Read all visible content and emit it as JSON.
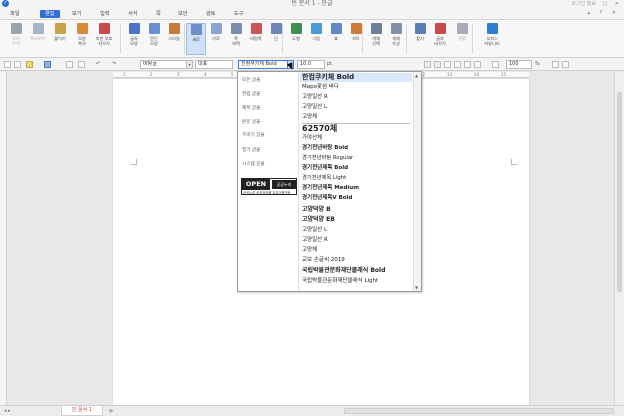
{
  "window": {
    "title": "빈 문서 1 - 한글",
    "logo": "✓",
    "login": "로그인 필요",
    "controls": "─ □ ✕"
  },
  "menubar": {
    "items": [
      {
        "label": "파일",
        "active": false
      },
      {
        "label": "편집",
        "active": true
      },
      {
        "label": "보기",
        "active": false
      },
      {
        "label": "입력",
        "active": false
      },
      {
        "label": "서식",
        "active": false
      },
      {
        "label": "쪽",
        "active": false
      },
      {
        "label": "보안",
        "active": false
      },
      {
        "label": "검토",
        "active": false
      },
      {
        "label": "도구",
        "active": false
      }
    ],
    "right_icons": "▴ ? ✕"
  },
  "ribbon": {
    "buttons": [
      {
        "label": "오려\n두기",
        "icon": "scissors-icon",
        "color": "#9aa3ad",
        "dim": true
      },
      {
        "label": "복사하기",
        "icon": "copy-icon",
        "color": "#a8b4c4",
        "dim": true
      },
      {
        "label": "붙이기",
        "icon": "paste-icon",
        "color": "#c9a24a",
        "dim": false
      },
      {
        "label": "모양\n복사",
        "icon": "format-painter-icon",
        "color": "#d68a3a",
        "dim": false
      },
      {
        "label": "조판 부호\n지우기",
        "icon": "clear-codes-icon",
        "color": "#c94a4a",
        "dim": false
      },
      {
        "label": "글자\n모양",
        "icon": "char-shape-icon",
        "color": "#4a74c9",
        "dim": false
      },
      {
        "label": "문단\n모양",
        "icon": "para-shape-icon",
        "color": "#6a8fd0",
        "dim": false
      },
      {
        "label": "스타일",
        "icon": "style-icon",
        "color": "#c97a3a",
        "dim": false
      },
      {
        "label": "세로",
        "icon": "portrait-icon",
        "color": "#6d8fc7",
        "dim": false,
        "selected": true
      },
      {
        "label": "가로",
        "icon": "landscape-icon",
        "color": "#8aa4cf",
        "dim": false
      },
      {
        "label": "쪽\n여백",
        "icon": "margin-icon",
        "color": "#7b8fb0",
        "dim": false
      },
      {
        "label": "바탕쪽",
        "icon": "master-page-icon",
        "color": "#c55",
        "dim": false
      },
      {
        "label": "단",
        "icon": "columns-icon",
        "color": "#6e86b5",
        "dim": false
      },
      {
        "label": "도형",
        "icon": "shape-icon",
        "color": "#3f8f52",
        "dim": false
      },
      {
        "label": "그림",
        "icon": "picture-icon",
        "color": "#4a9ad6",
        "dim": false
      },
      {
        "label": "표",
        "icon": "table-icon",
        "color": "#5f88c4",
        "dim": false
      },
      {
        "label": "차트",
        "icon": "chart-icon",
        "color": "#d07a3a",
        "dim": false
      },
      {
        "label": "개체\n선택",
        "icon": "select-object-icon",
        "color": "#6d7e99",
        "dim": false
      },
      {
        "label": "개체\n속성",
        "icon": "object-props-icon",
        "color": "#8291a8",
        "dim": false
      },
      {
        "label": "찾기",
        "icon": "find-icon",
        "color": "#5a7fb8",
        "dim": false
      },
      {
        "label": "글자\n바꾸기",
        "icon": "replace-icon",
        "color": "#c94a4a",
        "dim": false
      },
      {
        "label": "정렬",
        "icon": "sort-icon",
        "color": "#aab",
        "dim": true
      },
      {
        "label": "오피스\n커뮤니티",
        "icon": "community-icon",
        "color": "#2e7fd0",
        "dim": false
      }
    ]
  },
  "fmtbar": {
    "style_box": "바탕글",
    "lang_box": "대표",
    "font_box": "한컴쿠키체 Bold",
    "size_box": "10.0",
    "size_unit": "pt",
    "char_spacing": "100",
    "char_spacing_unit": "%",
    "style_arrow": "▾",
    "font_arrow": "▾"
  },
  "font_dropdown": {
    "categories": [
      "모든 글꼴",
      "한컴 글꼴",
      "제목 글꼴",
      "본문 글꼴",
      "꾸미기 글꼴",
      "필기 글꼴",
      "시스템 글꼴"
    ],
    "ogl": {
      "open": "OPEN",
      "badge": "공공누리",
      "text": "공공누리 공공저작물 자유이용허락"
    },
    "fonts": [
      {
        "name": "한컴쿠키체 Bold",
        "size": 7,
        "weight": "bold",
        "selected": true
      },
      {
        "name": "Mapo꽃섬 바다",
        "size": 5.5,
        "weight": "normal"
      },
      {
        "name": "고양일산 R",
        "size": 5.5,
        "weight": "normal"
      },
      {
        "name": "고양일산 L",
        "size": 5.5,
        "weight": "normal"
      },
      {
        "name": "고양체",
        "size": 5.5,
        "weight": "normal"
      },
      {
        "name": "62570체",
        "size": 8,
        "weight": "bold"
      },
      {
        "name": "가야산체",
        "size": 5.5,
        "weight": "normal"
      },
      {
        "name": "경기천년바탕 Bold",
        "size": 5.5,
        "weight": "bold"
      },
      {
        "name": "경기천년바탕 Regular",
        "size": 5.3,
        "weight": "normal"
      },
      {
        "name": "경기천년제목 Bold",
        "size": 5.5,
        "weight": "bold"
      },
      {
        "name": "경기천년제목 Light",
        "size": 5.3,
        "weight": "normal"
      },
      {
        "name": "경기천년제목 Medium",
        "size": 5.5,
        "weight": "bold"
      },
      {
        "name": "경기천년제목V Bold",
        "size": 5.5,
        "weight": "bold"
      },
      {
        "name": "고양덕양 B",
        "size": 6,
        "weight": "bold"
      },
      {
        "name": "고양덕양 EB",
        "size": 6,
        "weight": "bold"
      },
      {
        "name": "고양일산 L",
        "size": 5.5,
        "weight": "normal"
      },
      {
        "name": "고양일산 R",
        "size": 5.5,
        "weight": "normal"
      },
      {
        "name": "고양체",
        "size": 5.5,
        "weight": "normal"
      },
      {
        "name": "교보 손글씨 2019",
        "size": 5.5,
        "weight": "normal"
      },
      {
        "name": "국립박물관문화재단클래식 Bold",
        "size": 6,
        "weight": "bold"
      },
      {
        "name": "국립박물관문화재단클래식 Light",
        "size": 5.5,
        "weight": "normal"
      }
    ]
  },
  "ruler": {
    "ticks": [
      "1",
      "2",
      "3",
      "4",
      "5",
      "6",
      "7",
      "8",
      "9",
      "10",
      "11",
      "12",
      "13",
      "14",
      "15"
    ]
  },
  "bottombar": {
    "doc_tab": "빈 문서 1",
    "add_tab": "+",
    "nav": "◂ ▸"
  }
}
